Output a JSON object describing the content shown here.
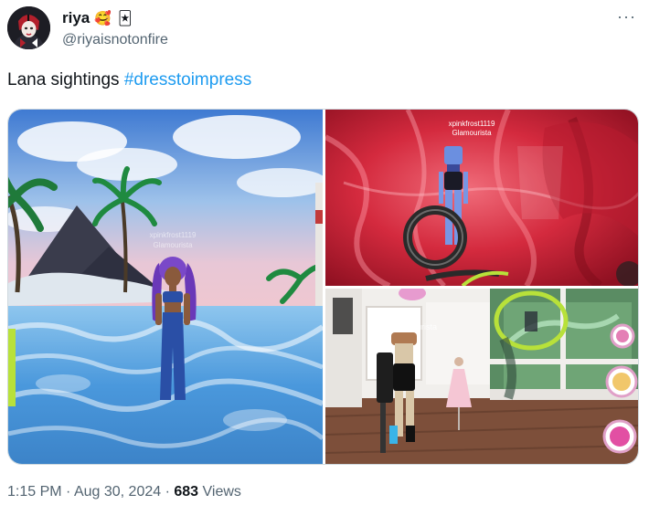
{
  "author": {
    "display_name": "riya",
    "emoji_1": "🥰",
    "emoji_2": "🃏",
    "handle": "@riyaisnotonfire",
    "avatar_icon": "harley-quinn-avatar-icon"
  },
  "more_icon": "more-options-icon",
  "tweet": {
    "text": "Lana sightings ",
    "hashtag": "#dresstoimpress"
  },
  "media": {
    "image_1": {
      "overlay_username": "xpinkfrost1119",
      "overlay_role": "Glamourista"
    },
    "image_2": {
      "overlay_username": "xpinkfrost1119",
      "overlay_role": "Glamourista"
    },
    "image_3": {
      "overlay_role": "urista"
    }
  },
  "meta": {
    "time": "1:15 PM",
    "sep1": " · ",
    "date": "Aug 30, 2024",
    "sep2": " · ",
    "views_count": "683",
    "views_label": " Views"
  },
  "colors": {
    "link": "#1d9bf0",
    "secondary_text": "#536471",
    "primary_text": "#0f1419"
  }
}
